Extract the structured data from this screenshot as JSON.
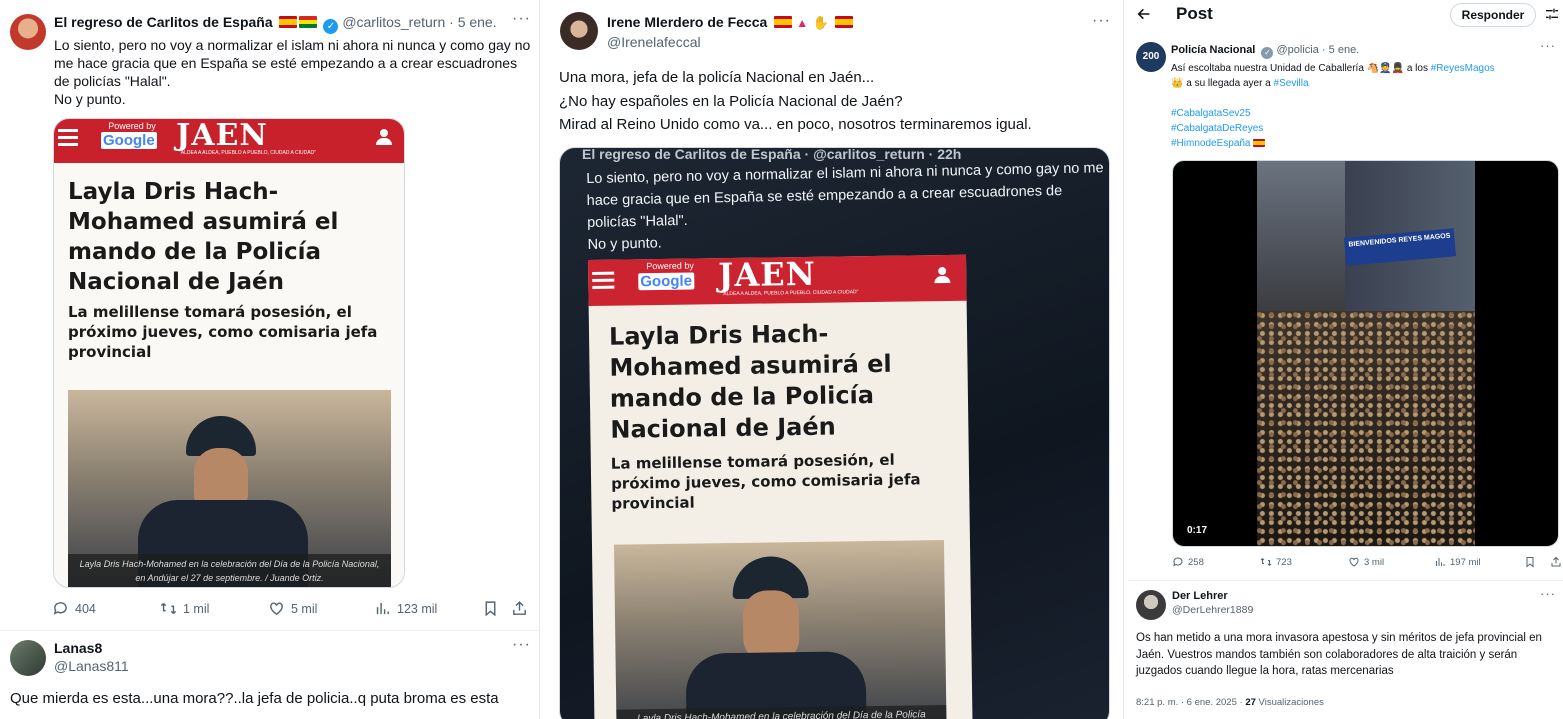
{
  "col1": {
    "tweet": {
      "name": "El regreso de Carlitos de España",
      "handle": "@carlitos_return",
      "dot": "·",
      "time": "5 ene.",
      "text": "Lo siento, pero no voy a normalizar el islam ni ahora ni nunca y como gay no me hace gracia que en España se esté empezando a a crear escuadrones de policías \"Halal\".\nNo y punto.",
      "replies": "404",
      "retweets": "1 mil",
      "likes": "5 mil",
      "views": "123 mil"
    },
    "reply": {
      "name": "Lanas8",
      "handle": "@Lanas811",
      "text": "Que mierda es esta...una mora??..la jefa de policia..q puta broma es esta"
    }
  },
  "article": {
    "powered_by": "Powered by",
    "google": "Google",
    "logo": "JAEN",
    "slogan": "\"ALDEA A ALDEA, PUEBLO A PUEBLO, CIUDAD A CIUDAD\"",
    "headline": "Layla Dris Hach-Mohamed asumirá el mando de la Policía Nacional de Jaén",
    "subhead": "La melillense tomará posesión, el próximo jueves, como comisaria jefa provincial",
    "caption": "Layla Dris Hach-Mohamed en la celebración del Día de la Policía Nacional, en Andújar el 27 de septiembre. / Juande Ortiz.",
    "caption_short": "Layla Dris Hach-Mohamed en la celebración del Día de la Policía"
  },
  "col2": {
    "name": "Irene MIerdero de Fecca",
    "handle": "@Irenelafeccal",
    "text": "Una mora, jefa de la policía Nacional en Jaén...\n¿No hay españoles en la Policía Nacional de Jaén?\nMirad al Reino Unido como va... en poco, nosotros terminaremos igual.",
    "photo_header": "El regreso de Carlitos de España · @carlitos_return · 22h",
    "photo_text": "Lo siento, pero no voy a normalizar el islam ni ahora ni nunca y como gay no me hace gracia que en España se esté empezando a a crear escuadrones de policías \"Halal\".\nNo y punto."
  },
  "col3": {
    "header_title": "Post",
    "reply_button": "Responder",
    "tweet": {
      "name": "Policía Nacional",
      "handle": "@policia",
      "time": "5 ene.",
      "text_before": "Así escoltaba nuestra Unidad de Caballería",
      "text_mid": "a los",
      "hashtag_reyes": "#ReyesMagos",
      "text_after": "a su llegada ayer a",
      "hashtag_sevilla": "#Sevilla",
      "hashtags": [
        "#CabalgataSev25",
        "#CabalgataDeReyes",
        "#HimnodeEspaña"
      ],
      "video_time": "0:17",
      "banner": "BIENVENIDOS REYES MAGOS",
      "replies": "258",
      "retweets": "723",
      "likes": "3 mil",
      "views": "197 mil",
      "avatar_text": "200"
    },
    "reply": {
      "name": "Der Lehrer",
      "handle": "@DerLehrer1889",
      "text": "Os han metido a una mora invasora apestosa y sin méritos de jefa provincial en Jaén. Vuestros mandos también son colaboradores de alta traición y serán juzgados cuando llegue la hora, ratas mercenarias",
      "meta_time": "8:21 p. m. · 6 ene. 2025 ·",
      "views_count": "27",
      "views_label": "Visualizaciones"
    }
  },
  "colors": {
    "accent": "#1d9bf0",
    "jaen_red": "#c8212b",
    "muted": "#536471"
  }
}
